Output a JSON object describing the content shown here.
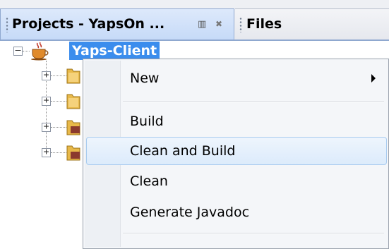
{
  "tabs": [
    {
      "label": "Projects - YapsOn ...",
      "active": true
    },
    {
      "label": "Files",
      "active": false
    }
  ],
  "tab_controls": {
    "minimize_icon": "minimize-window-icon",
    "close_icon": "close-icon"
  },
  "tree": {
    "root": {
      "label": "Yaps-Client",
      "icon": "java-cup-project-icon",
      "expanded": true
    },
    "children_icons": [
      "source-package-folder-icon",
      "test-package-folder-icon",
      "libraries-folder-icon",
      "test-libraries-folder-icon"
    ]
  },
  "context_menu": {
    "items": [
      {
        "label": "New",
        "submenu": true
      },
      {
        "label": "Build"
      },
      {
        "label": "Clean and Build",
        "highlighted": true
      },
      {
        "label": "Clean"
      },
      {
        "label": "Generate Javadoc"
      }
    ]
  },
  "colors": {
    "selection": "#3b8ded",
    "menu_hover_border": "#a8cbef",
    "tab_active": "#c6daf8"
  }
}
